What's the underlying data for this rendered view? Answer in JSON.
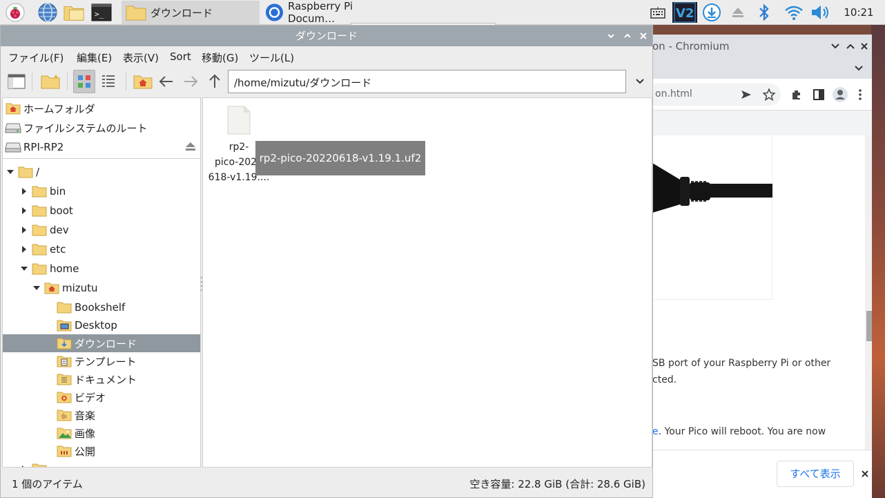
{
  "taskbar": {
    "file_manager_task": "ダウンロード",
    "browser_task": "Raspberry Pi Docum…",
    "clock": "10:21"
  },
  "file_manager": {
    "title": "ダウンロード",
    "menus": [
      "ファイル(F)",
      "編集(E)",
      "表示(V)",
      "Sort",
      "移動(G)",
      "ツール(L)"
    ],
    "path": "/home/mizutu/ダウンロード",
    "places": [
      "ホームフォルダ",
      "ファイルシステムのルート",
      "RPI-RP2"
    ],
    "tree": {
      "root": "/",
      "bin": "bin",
      "boot": "boot",
      "dev": "dev",
      "etc": "etc",
      "home": "home",
      "user": "mizutu",
      "children": [
        "Bookshelf",
        "Desktop",
        "ダウンロード",
        "テンプレート",
        "ドキュメント",
        "ビデオ",
        "音楽",
        "画像",
        "公開"
      ]
    },
    "file": {
      "label_lines": [
        "rp2-",
        "pico-2022",
        "618-v1.19...."
      ],
      "tooltip": "rp2-pico-20220618-v1.19.1.uf2"
    },
    "status_left": "1 個のアイテム",
    "status_right": "空き容量: 22.8 GiB (合計: 28.6 GiB)"
  },
  "browser": {
    "title_fragment": "on - Chromium",
    "url_fragment": "on.html",
    "text_lines": [
      "SB port of your Raspberry Pi or other",
      "cted.",
      "e. Your Pico will reboot. You are now"
    ],
    "show_all_button": "すべて表示"
  },
  "colors": {
    "fm_titlebar": "#9ea7ad",
    "tree_selection": "#8e989e",
    "folder": "#f5d37a",
    "chrome_accent": "#1a73e8"
  }
}
